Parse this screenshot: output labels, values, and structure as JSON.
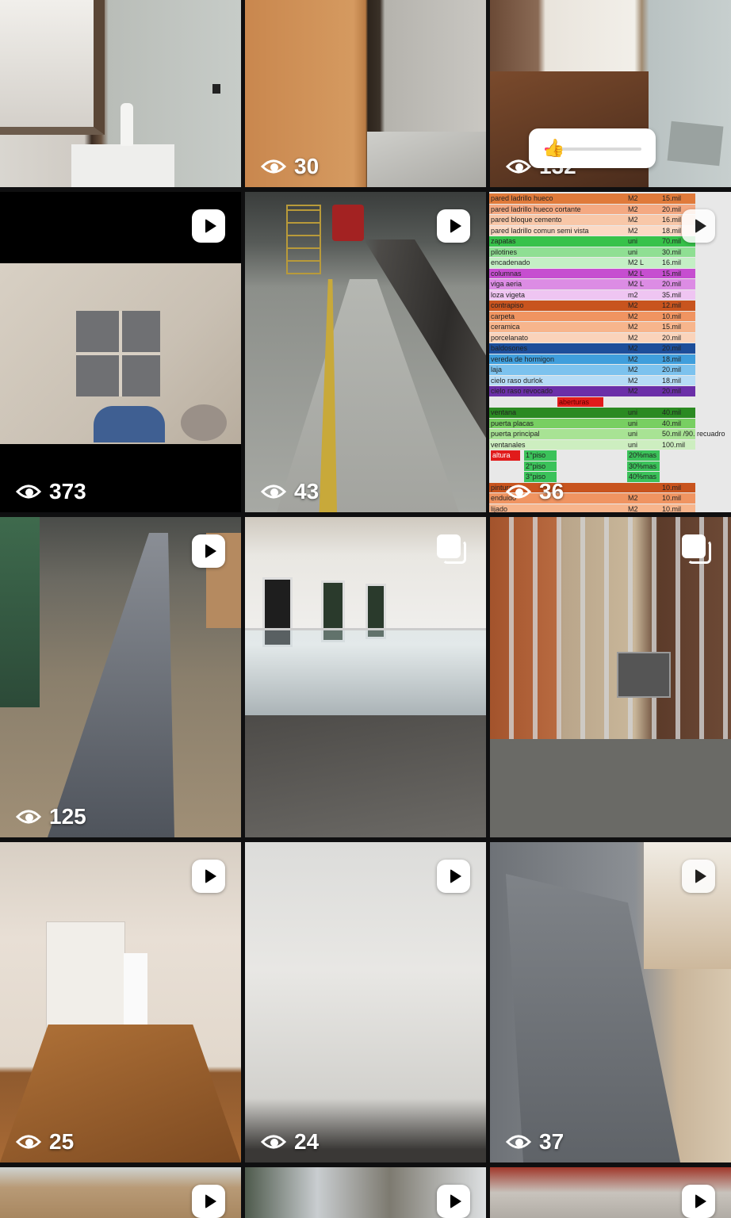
{
  "tiles": [
    {
      "id": "t1",
      "views": "",
      "badge": "none"
    },
    {
      "id": "t2",
      "views": "30",
      "badge": "none"
    },
    {
      "id": "t3",
      "views": "132",
      "badge": "none"
    },
    {
      "id": "t4",
      "views": "373",
      "badge": "reel"
    },
    {
      "id": "t5",
      "views": "43",
      "badge": "reel"
    },
    {
      "id": "t6",
      "views": "36",
      "badge": "reel"
    },
    {
      "id": "t7",
      "views": "125",
      "badge": "reel"
    },
    {
      "id": "t8",
      "views": "",
      "badge": "carousel"
    },
    {
      "id": "t9",
      "views": "",
      "badge": "carousel"
    },
    {
      "id": "t10",
      "views": "25",
      "badge": "reel"
    },
    {
      "id": "t11",
      "views": "24",
      "badge": "reel"
    },
    {
      "id": "t12",
      "views": "37",
      "badge": "reel"
    },
    {
      "id": "t13",
      "views": "",
      "badge": "reel"
    },
    {
      "id": "t14",
      "views": "",
      "badge": "reel"
    },
    {
      "id": "t15",
      "views": "",
      "badge": "reel"
    }
  ],
  "slider_sticker": {
    "emoji": "👍",
    "level_fraction": 0.05
  },
  "spreadsheet": {
    "rows": [
      [
        "pared ladrillo hueco",
        "M2",
        "15.mil"
      ],
      [
        "pared ladrillo hueco cortante",
        "M2",
        "20.mil"
      ],
      [
        "pared bloque cemento",
        "M2",
        "16.mil"
      ],
      [
        "pared ladrillo comun  semi vista",
        "M2",
        "18.mil"
      ],
      [
        "zapatas",
        "uni",
        "70.mil"
      ],
      [
        "pilotines",
        "uni",
        "30.mil"
      ],
      [
        "encadenado",
        "M2 L",
        "16.mil"
      ],
      [
        "columnas",
        "M2 L",
        "15.mil"
      ],
      [
        "viga aeria",
        "M2 L",
        "20.mil"
      ],
      [
        "loza vigeta",
        "m2",
        "35.mil"
      ],
      [
        "contrapiso",
        "M2",
        "12.mil"
      ],
      [
        "carpeta",
        "M2",
        "10.mil"
      ],
      [
        "ceramica",
        "M2",
        "15.mil"
      ],
      [
        "porcelanato",
        "M2",
        "20.mil"
      ],
      [
        "baldosones",
        "M2",
        "20.mil"
      ],
      [
        "vereda de hormigon",
        "M2",
        "18.mil"
      ],
      [
        "laja",
        "M2",
        "20.mil"
      ],
      [
        "cielo raso durlok",
        "M2",
        "18.mil"
      ],
      [
        "cielo raso revocado",
        "M2",
        "20.mil"
      ],
      [
        "aberturas",
        "",
        ""
      ],
      [
        "ventana",
        "uni",
        "40.mil"
      ],
      [
        "puerta placas",
        "uni",
        "40.mil"
      ],
      [
        "puerta principal",
        "uni",
        "50.mil /90. recuadro"
      ],
      [
        "ventanales",
        "uni",
        "100.mil"
      ],
      [
        "altura",
        "1°piso",
        "20%mas"
      ],
      [
        "",
        "2°piso",
        "30%mas"
      ],
      [
        "",
        "3°piso",
        "40%mas"
      ],
      [
        "pintura",
        "",
        "10.mil"
      ],
      [
        "enduido",
        "M2",
        "10.mil"
      ],
      [
        "lijado",
        "M2",
        "10.mil"
      ]
    ],
    "row_colors": [
      "#e07a3a",
      "#f4a982",
      "#f8c7a8",
      "#fbd9c4",
      "#37c24a",
      "#8fdf93",
      "#c4efc5",
      "#c64ed0",
      "#dc8ce4",
      "#efc5f2",
      "#c8541e",
      "#f09461",
      "#f7b58c",
      "#fad3ba",
      "#1d4e9a",
      "#3f9edc",
      "#7cc2ee",
      "#b6dcf6",
      "#6b2fa8",
      "#e8e8e8",
      "#2b8a22",
      "#78cf62",
      "#a8e394",
      "#cdeec0",
      "#e8e8e8",
      "#e8e8e8",
      "#e8e8e8",
      "#c8541e",
      "#f09461",
      "#f7b58c"
    ],
    "accent_red": "#e11b1b",
    "accent_green": "#3bc25a"
  }
}
